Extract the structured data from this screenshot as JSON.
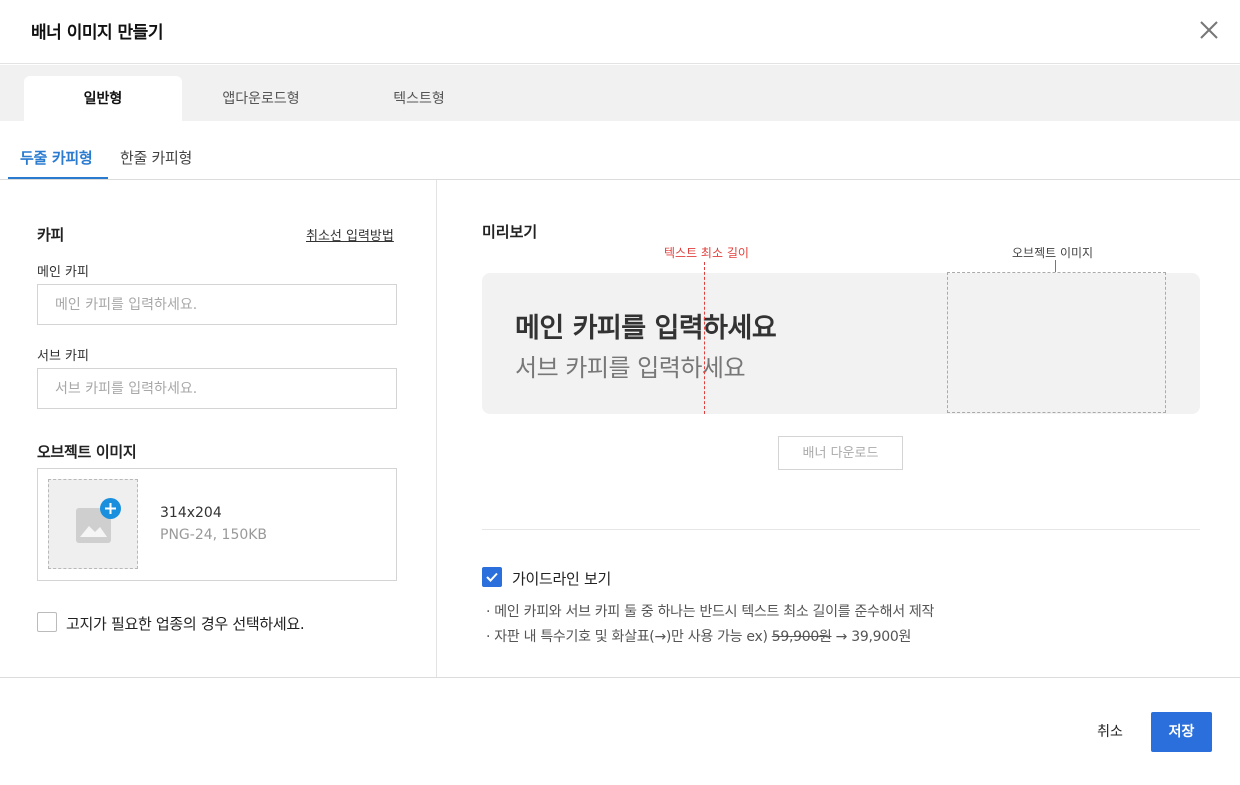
{
  "dialog": {
    "title": "배너 이미지 만들기",
    "close_icon": "close-icon"
  },
  "tabs": [
    {
      "label": "일반형",
      "active": true
    },
    {
      "label": "앱다운로드형",
      "active": false
    },
    {
      "label": "텍스트형",
      "active": false
    }
  ],
  "subtabs": [
    {
      "label": "두줄 카피형",
      "active": true
    },
    {
      "label": "한줄 카피형",
      "active": false
    }
  ],
  "form": {
    "copy_title": "카피",
    "input_method_link": "취소선 입력방법",
    "main_copy_label": "메인 카피",
    "main_copy_placeholder": "메인 카피를 입력하세요.",
    "main_copy_value": "",
    "sub_copy_label": "서브 카피",
    "sub_copy_placeholder": "서브 카피를 입력하세요.",
    "sub_copy_value": "",
    "object_image_title": "오브젝트 이미지",
    "object_size": "314x204",
    "object_format": "PNG-24, 150KB",
    "notice_checkbox_label": "고지가 필요한 업종의 경우 선택하세요.",
    "notice_checked": false
  },
  "preview": {
    "title": "미리보기",
    "guide_min_length_label": "텍스트 최소 길이",
    "guide_object_label": "오브젝트 이미지",
    "banner_main": "메인 카피를 입력하세요",
    "banner_sub": "서브 카피를 입력하세요",
    "download_button": "배너 다운로드",
    "guideline_label": "가이드라인 보기",
    "guideline_checked": true,
    "note1": "· 메인 카피와 서브 카피 둘 중 하나는 반드시 텍스트 최소 길이를 준수해서 제작",
    "note2_prefix": "· 자판 내 특수기호 및 화살표(→)만 사용 가능 ex) ",
    "note2_strike": "59,900원",
    "note2_suffix": " → 39,900원"
  },
  "footer": {
    "cancel": "취소",
    "save": "저장"
  },
  "colors": {
    "accent": "#2a6fdb",
    "tab_active": "#2a7bd0",
    "guide_red": "#e0403d"
  }
}
